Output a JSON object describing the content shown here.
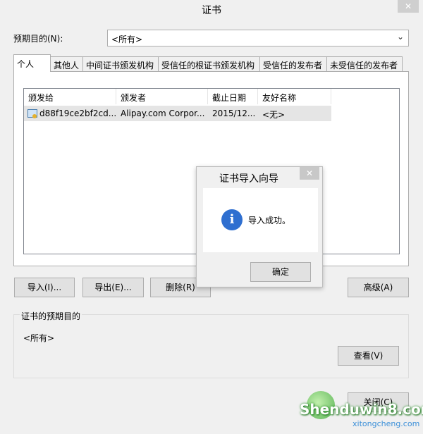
{
  "window": {
    "title": "证书",
    "close_glyph": "✕"
  },
  "purpose": {
    "label": "预期目的(N):",
    "selected": "<所有>"
  },
  "tabs": [
    "个人",
    "其他人",
    "中间证书颁发机构",
    "受信任的根证书颁发机构",
    "受信任的发布者",
    "未受信任的发布者"
  ],
  "table": {
    "columns": [
      "颁发给",
      "颁发者",
      "截止日期",
      "友好名称"
    ],
    "rows": [
      {
        "issued_to": "d88f19ce2bf2cd...",
        "issued_by": "Alipay.com Corpor...",
        "expires": "2015/12...",
        "friendly_name": "<无>"
      }
    ]
  },
  "buttons": {
    "import": "导入(I)...",
    "export": "导出(E)...",
    "remove": "删除(R)",
    "advanced": "高级(A)",
    "view": "查看(V)",
    "close": "关闭(C)"
  },
  "purposes_group": {
    "title": "证书的预期目的",
    "value": "<所有>"
  },
  "dialog": {
    "title": "证书导入向导",
    "message": "导入成功。",
    "ok": "确定",
    "close_glyph": "✕"
  },
  "watermark": {
    "brand": "Shenduwin8.com",
    "sub": "xitongcheng.com"
  },
  "colors": {
    "info_icon": "#2f6fd0",
    "selected_row": "#e5e5e5",
    "button_face": "#e1e1e1"
  }
}
